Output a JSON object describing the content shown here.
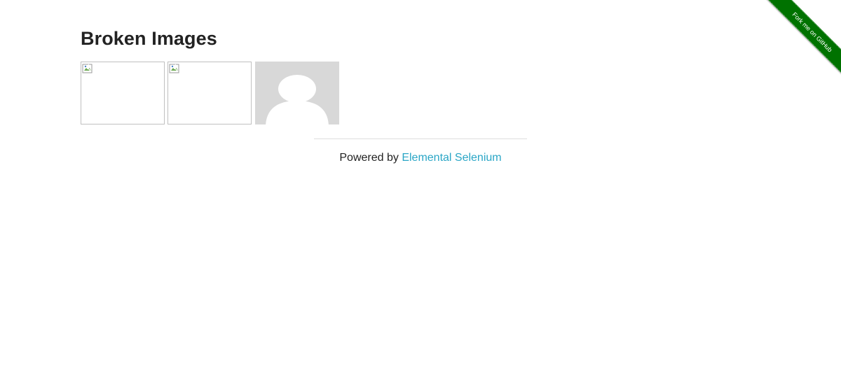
{
  "header": {
    "title": "Broken Images"
  },
  "images": [
    {
      "state": "broken",
      "icon": "broken-image-icon"
    },
    {
      "state": "broken",
      "icon": "broken-image-icon"
    },
    {
      "state": "loaded",
      "icon": "avatar-placeholder-icon"
    }
  ],
  "footer": {
    "prefix": "Powered by ",
    "link_text": "Elemental Selenium"
  },
  "ribbon": {
    "text": "Fork me on GitHub",
    "color": "#007200"
  },
  "colors": {
    "link": "#2aa6c6",
    "avatar_bg": "#d8d8d8",
    "avatar_fg": "#ffffff"
  }
}
